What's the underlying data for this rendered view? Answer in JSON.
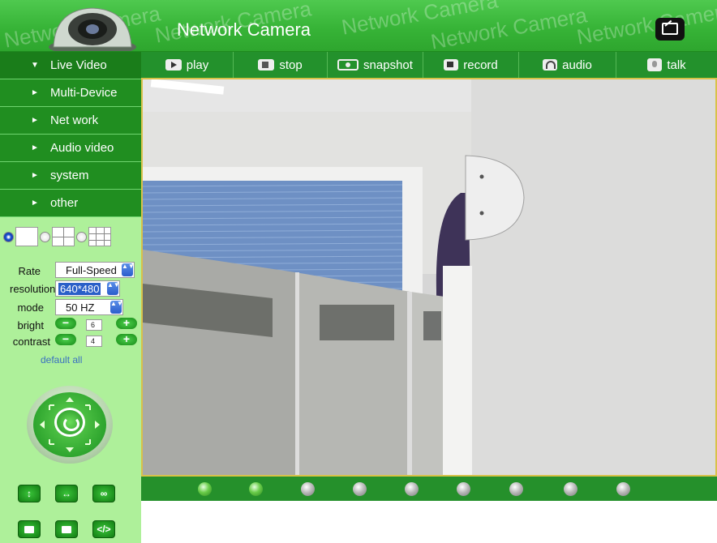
{
  "header": {
    "title": "Network Camera",
    "watermark": "Network Camera"
  },
  "sidebar": {
    "nav": [
      {
        "label": "Live Video",
        "expanded": true
      },
      {
        "label": "Multi-Device",
        "expanded": false
      },
      {
        "label": "Net work",
        "expanded": false
      },
      {
        "label": "Audio video",
        "expanded": false
      },
      {
        "label": "system",
        "expanded": false
      },
      {
        "label": "other",
        "expanded": false
      }
    ],
    "split_modes": [
      "single-view",
      "quad-view",
      "nine-view"
    ],
    "split_selected": "single-view",
    "controls": {
      "rate_label": "Rate",
      "rate_value": "Full-Speed",
      "resolution_label": "resolution",
      "resolution_value": "640*480",
      "mode_label": "mode",
      "mode_value": "50 HZ",
      "bright_label": "bright",
      "bright_value": "6",
      "contrast_label": "contrast",
      "contrast_value": "4",
      "default_all": "default all"
    },
    "bottom_buttons": [
      "flip-vertical-icon",
      "flip-horizontal-icon",
      "loop-icon",
      "preset-1-icon",
      "preset-2-icon",
      "code-icon"
    ],
    "buttons": {
      "minus": "−",
      "plus": "+",
      "flip_v": "↕",
      "flip_h": "↔",
      "loop": "∞",
      "code": "</>",
      "spin": "▲▼",
      "nav_open": "▼",
      "nav_closed": "►"
    }
  },
  "toolbar": {
    "buttons": [
      {
        "label": "play",
        "icon": "play-icon"
      },
      {
        "label": "stop",
        "icon": "stop-icon"
      },
      {
        "label": "snapshot",
        "icon": "snapshot-icon"
      },
      {
        "label": "record",
        "icon": "record-icon"
      },
      {
        "label": "audio",
        "icon": "audio-icon"
      },
      {
        "label": "talk",
        "icon": "talk-icon"
      }
    ]
  },
  "channels": {
    "count": 9,
    "active": [
      1,
      2
    ]
  },
  "colors": {
    "primary_green": "#23912c",
    "sidebar_bg": "#aef09a",
    "video_border": "#d8c24a"
  }
}
